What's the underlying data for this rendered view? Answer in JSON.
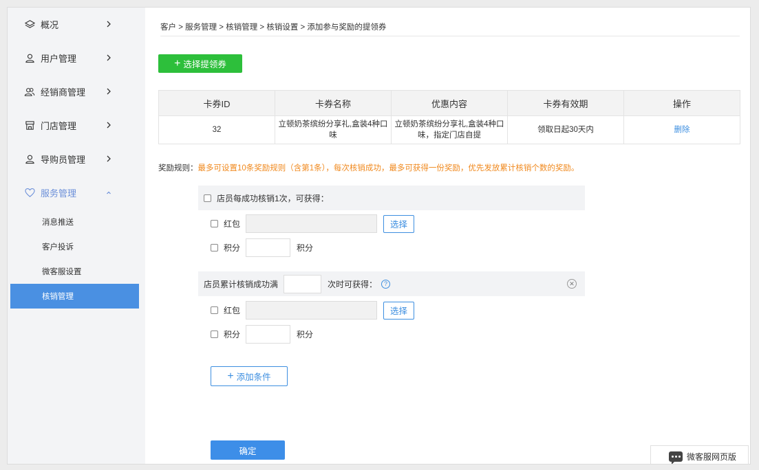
{
  "sidebar": {
    "items": [
      {
        "label": "概况",
        "icon": "layers-icon"
      },
      {
        "label": "用户管理",
        "icon": "user-icon"
      },
      {
        "label": "经销商管理",
        "icon": "users-icon"
      },
      {
        "label": "门店管理",
        "icon": "store-icon"
      },
      {
        "label": "导购员管理",
        "icon": "user-icon"
      },
      {
        "label": "服务管理",
        "icon": "heart-icon",
        "expanded": true
      }
    ],
    "sub_items": [
      {
        "label": "消息推送"
      },
      {
        "label": "客户投诉"
      },
      {
        "label": "微客服设置"
      },
      {
        "label": "核销管理",
        "active": true
      }
    ]
  },
  "breadcrumb": "客户 > 服务管理 > 核销管理 > 核销设置 > 添加参与奖励的提领券",
  "select_coupon_button": "选择提领券",
  "table": {
    "headers": [
      "卡券ID",
      "卡券名称",
      "优惠内容",
      "卡券有效期",
      "操作"
    ],
    "rows": [
      {
        "id": "32",
        "name": "立顿奶茶缤纷分享礼,盒装4种口味",
        "discount": "立顿奶茶缤纷分享礼,盒装4种口味，指定门店自提",
        "validity": "领取日起30天内",
        "action": "删除"
      }
    ]
  },
  "reward_rule": {
    "label": "奖励规则：",
    "text": "最多可设置10条奖励规则（含第1条），每次核销成功，最多可获得一份奖励，优先发放累计核销个数的奖励。"
  },
  "rule1": {
    "title": "店员每成功核销1次，可获得：",
    "redpacket_label": "红包",
    "select_label": "选择",
    "points_label": "积分",
    "points_unit": "积分"
  },
  "rule2": {
    "title_prefix": "店员累计核销成功满",
    "title_suffix": "次时可获得：",
    "help": "?",
    "redpacket_label": "红包",
    "select_label": "选择",
    "points_label": "积分",
    "points_unit": "积分"
  },
  "add_condition_button": "添加条件",
  "confirm_button": "确定",
  "float_chat": "微客服网页版",
  "colors": {
    "green": "#2dbf3b",
    "blue": "#3c8ee0",
    "warning": "#f0891e",
    "active_nav": "#4a90e2"
  }
}
